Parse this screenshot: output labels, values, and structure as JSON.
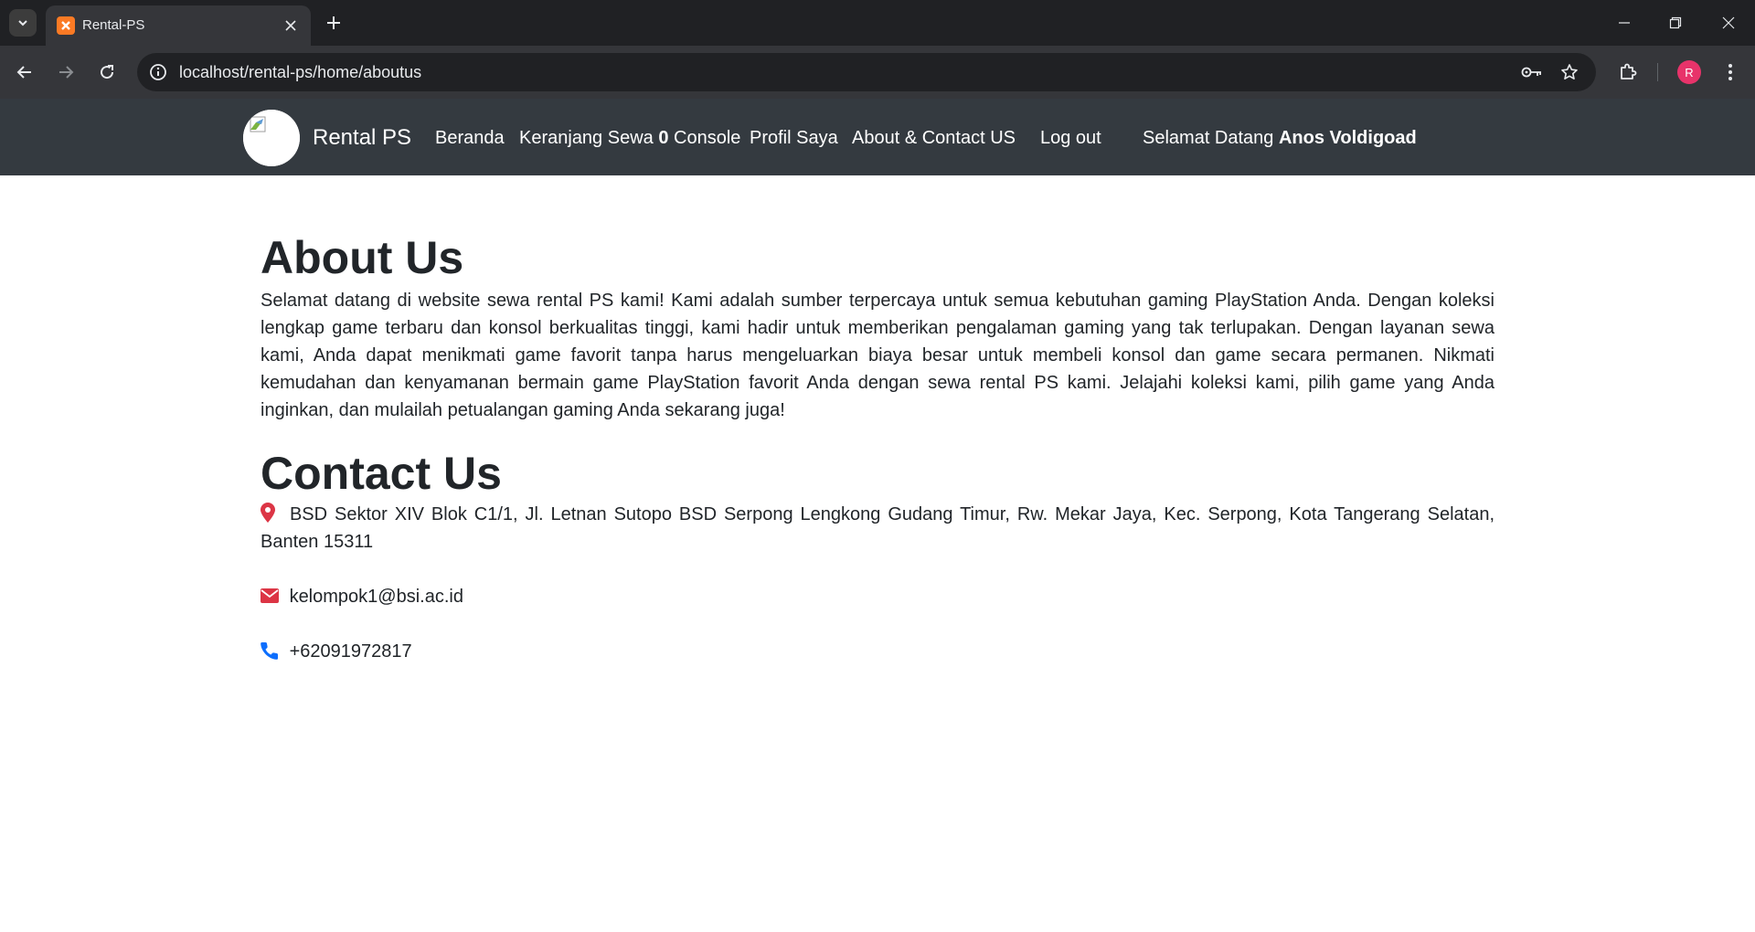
{
  "browser": {
    "tab_title": "Rental-PS",
    "url": "localhost/rental-ps/home/aboutus",
    "profile_initial": "R"
  },
  "navbar": {
    "brand": "Rental PS",
    "links": {
      "home": "Beranda",
      "cart_prefix": "Keranjang Sewa",
      "cart_count": "0",
      "cart_suffix": "Console",
      "profile": "Profil Saya",
      "about": "About & Contact US",
      "logout": "Log out"
    },
    "welcome_prefix": "Selamat Datang",
    "username": "Anos Voldigoad"
  },
  "about": {
    "title": "About Us",
    "text": "Selamat datang di website sewa rental PS kami! Kami adalah sumber terpercaya untuk semua kebutuhan gaming PlayStation Anda. Dengan koleksi lengkap game terbaru dan konsol berkualitas tinggi, kami hadir untuk memberikan pengalaman gaming yang tak terlupakan. Dengan layanan sewa kami, Anda dapat menikmati game favorit tanpa harus mengeluarkan biaya besar untuk membeli konsol dan game secara permanen. Nikmati kemudahan dan kenyamanan bermain game PlayStation favorit Anda dengan sewa rental PS kami. Jelajahi koleksi kami, pilih game yang Anda inginkan, dan mulailah petualangan gaming Anda sekarang juga!"
  },
  "contact": {
    "title": "Contact Us",
    "address": "BSD Sektor XIV Blok C1/1, Jl. Letnan Sutopo BSD Serpong Lengkong Gudang Timur, Rw. Mekar Jaya, Kec. Serpong, Kota Tangerang Selatan, Banten 15311",
    "email": "kelompok1@bsi.ac.id",
    "phone": "+62091972817"
  },
  "colors": {
    "navbar_bg": "#343a40",
    "map_marker": "#dc3545",
    "envelope": "#dc3545",
    "phone": "#0d6efd"
  }
}
